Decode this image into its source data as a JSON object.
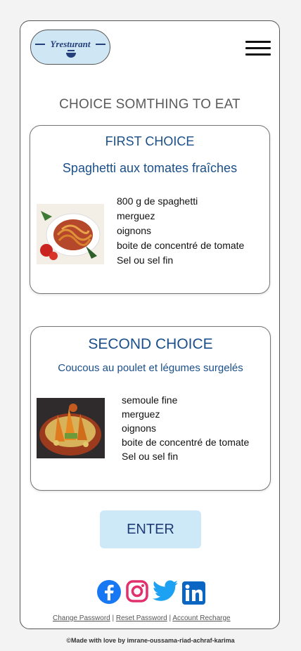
{
  "logo": {
    "text": "Yresturant"
  },
  "header": {
    "menu_icon": "hamburger-menu-icon"
  },
  "page": {
    "heading": "CHOICE SOMTHING TO EAT"
  },
  "choices": [
    {
      "title": "FIRST CHOICE",
      "dish": "Spaghetti aux tomates fraîches",
      "ingredients": [
        "800 g de spaghetti",
        "merguez",
        "oignons",
        "boite de concentré de tomate",
        "Sel ou sel fin"
      ]
    },
    {
      "title": "SECOND CHOICE",
      "dish": "Coucous au poulet et légumes surgelés",
      "ingredients": [
        "semoule fine",
        "merguez",
        "oignons",
        "boite de concentré de tomate",
        "Sel ou sel fin"
      ]
    }
  ],
  "actions": {
    "enter_label": "ENTER"
  },
  "social": [
    "facebook-icon",
    "instagram-icon",
    "twitter-icon",
    "linkedin-icon"
  ],
  "footer": {
    "links": [
      "Change Password",
      "Reset Password",
      "Account Recharge"
    ],
    "separator": "|",
    "credit": "©Made with love by  imrane-oussama-riad-achraf-karima"
  },
  "colors": {
    "accent": "#1a4f8a",
    "button_bg": "#cde8f6",
    "logo_bg": "#cfe6f4"
  }
}
